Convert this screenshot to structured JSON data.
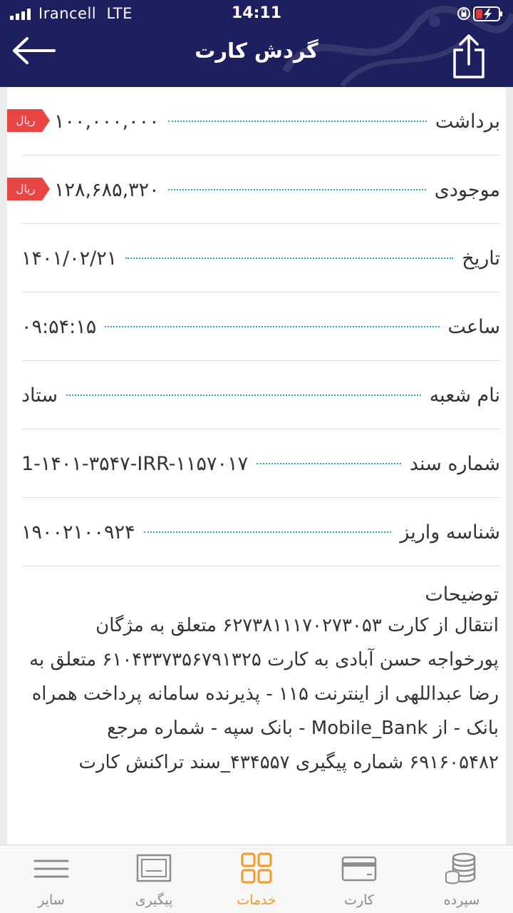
{
  "status_bar": {
    "carrier": "Irancell",
    "network": "LTE",
    "time": "14:11"
  },
  "header": {
    "title": "گردش کارت",
    "back_icon": "arrow-left-icon",
    "share_icon": "share-icon"
  },
  "details": [
    {
      "label": "برداشت",
      "value": "۱۰۰,۰۰۰,۰۰۰",
      "badge": "ریال"
    },
    {
      "label": "موجودی",
      "value": "۱۲۸,۶۸۵,۳۲۰",
      "badge": "ریال"
    },
    {
      "label": "تاریخ",
      "value": "۱۴۰۱/۰۲/۲۱"
    },
    {
      "label": "ساعت",
      "value": "۰۹:۵۴:۱۵"
    },
    {
      "label": "نام شعبه",
      "value": "ستاد"
    },
    {
      "label": "شماره سند",
      "value": "1-۱۴۰۱-۳۵۴۷-IRR-۱۱۵۷۰۱۷"
    },
    {
      "label": "شناسه واریز",
      "value": "۱۹۰۰۲۱۰۰۹۲۴"
    }
  ],
  "description": {
    "title": "توضیحات",
    "text": "انتقال از کارت ۶۲۷۳۸۱۱۱۷۰۲۷۳۰۵۳ متعلق به مژگان پورخواجه حسن آبادی به کارت ۶۱۰۴۳۳۷۳۵۶۷۹۱۳۲۵ متعلق به  رضا  عبداللهی از اینترنت ۱۱۵ - پذیرنده سامانه پرداخت همراه بانک - از Mobile_Bank - بانک سپه - شماره مرجع ۶۹۱۶۰۵۴۸۲ شماره پیگیری ۴۳۴۵۵۷_سند تراکنش کارت"
  },
  "tabs": [
    {
      "label": "سایر",
      "icon": "menu-icon"
    },
    {
      "label": "پیگیری",
      "icon": "receipt-icon"
    },
    {
      "label": "خدمات",
      "icon": "grid-icon",
      "active": true
    },
    {
      "label": "کارت",
      "icon": "card-icon"
    },
    {
      "label": "سپرده",
      "icon": "coins-icon"
    }
  ],
  "colors": {
    "header_bg": "#1d1f5e",
    "rial_badge": "#e84545",
    "dots": "#2aa3d6",
    "active_tab": "#f49a25"
  }
}
